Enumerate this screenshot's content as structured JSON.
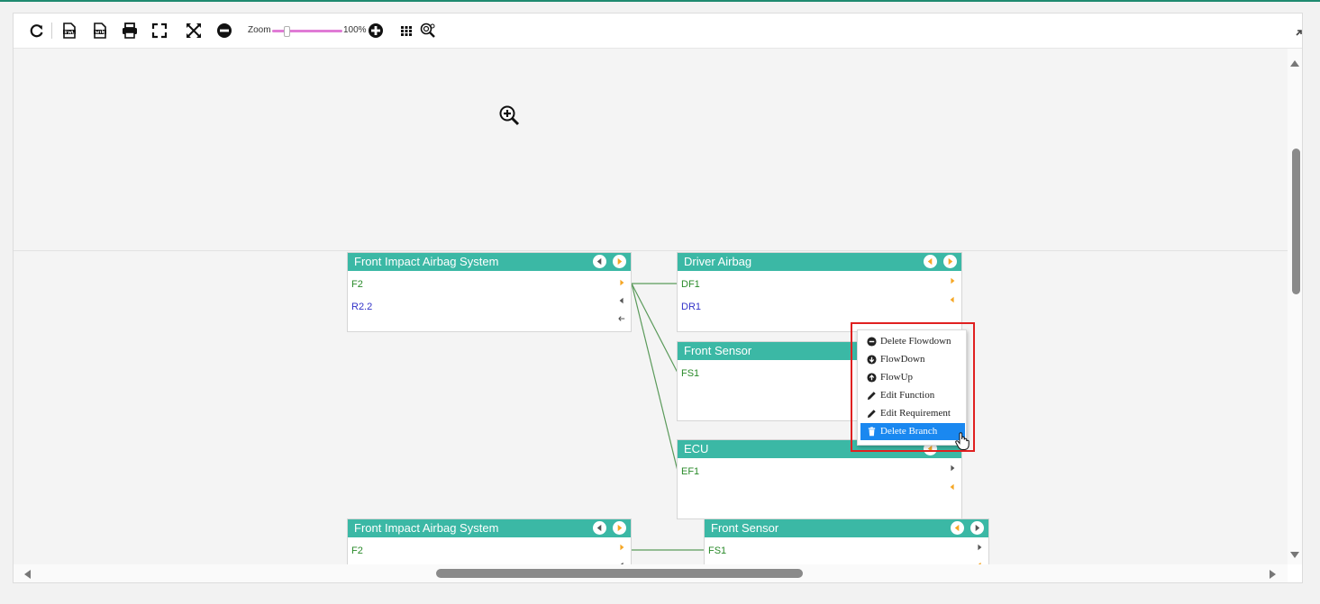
{
  "toolbar": {
    "zoom_label": "Zoom",
    "zoom_value": "100%",
    "zoom_fraction": 0.2,
    "icons": [
      "refresh-icon",
      "export-xml-icon",
      "export-word-icon",
      "print-icon",
      "fullscreen-icon",
      "fit-to-screen-icon",
      "zoom-out-icon",
      "zoom-in-icon",
      "grid-icon",
      "search-zoom-icon",
      "collapse-icon"
    ]
  },
  "colors": {
    "node_header": "#3bb8a5",
    "function_text": "#2a8a2a",
    "requirement_text": "#3232c8",
    "nav_arrow_orange": "#f5a623",
    "link_line": "#5a9a5a",
    "highlight_red": "#e02020",
    "menu_active": "#1a88f0"
  },
  "nodes": {
    "front_impact_1": {
      "title": "Front Impact Airbag System",
      "rows": [
        {
          "label": "F2"
        },
        {
          "label": "R2.2"
        }
      ]
    },
    "driver_airbag": {
      "title": "Driver Airbag",
      "rows": [
        {
          "label": "DF1"
        },
        {
          "label": "DR1"
        }
      ]
    },
    "front_sensor_1": {
      "title": "Front  Sensor",
      "rows": [
        {
          "label": "FS1"
        }
      ]
    },
    "ecu": {
      "title": "ECU",
      "rows": [
        {
          "label": "EF1"
        }
      ]
    },
    "front_impact_2": {
      "title": "Front Impact Airbag System",
      "rows": [
        {
          "label": "F2"
        }
      ]
    },
    "front_sensor_2": {
      "title": "Front  Sensor",
      "rows": [
        {
          "label": "FS1"
        }
      ]
    }
  },
  "context_menu": {
    "items": [
      {
        "label": "Delete Flowdown",
        "icon": "minus-circle-icon"
      },
      {
        "label": "FlowDown",
        "icon": "arrow-down-circle-icon"
      },
      {
        "label": "FlowUp",
        "icon": "arrow-up-circle-icon"
      },
      {
        "label": "Edit Function",
        "icon": "pencil-icon"
      },
      {
        "label": "Edit Requirement",
        "icon": "pencil-icon"
      },
      {
        "label": "Delete Branch",
        "icon": "trash-icon",
        "active": true
      }
    ]
  }
}
